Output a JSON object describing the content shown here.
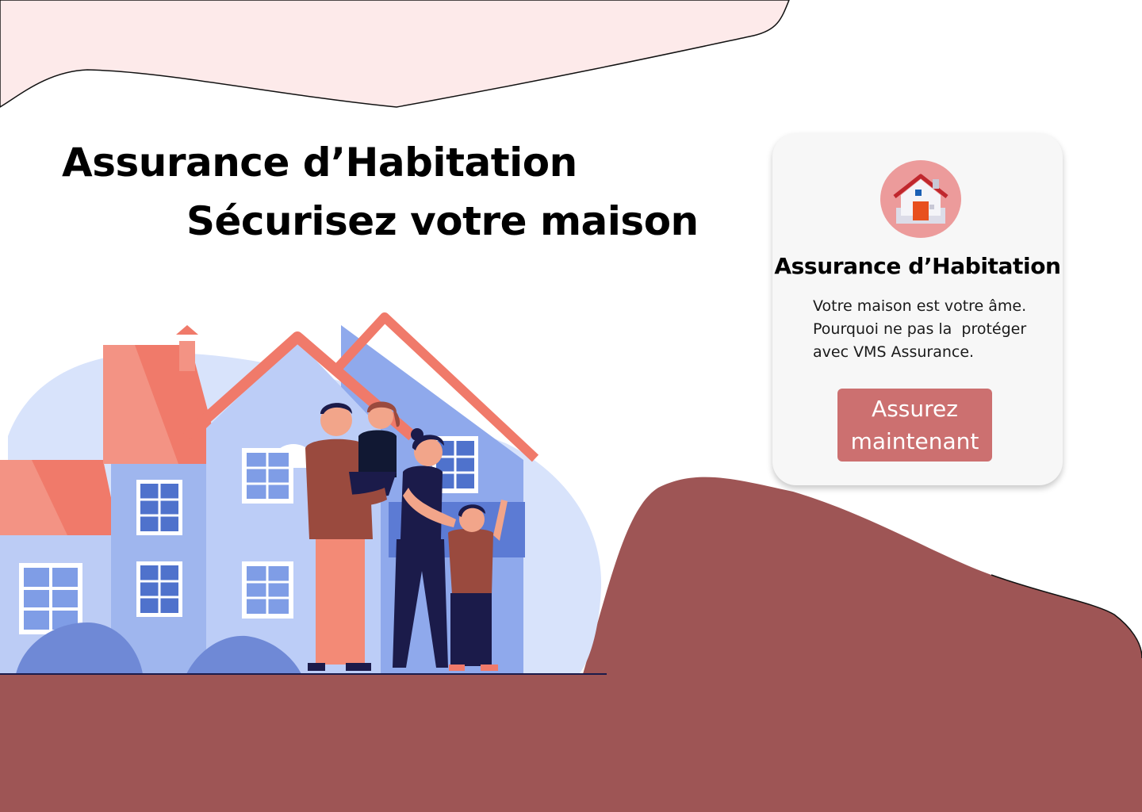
{
  "hero": {
    "title": "Assurance d’Habitation",
    "subtitle": "Sécurisez votre maison"
  },
  "card": {
    "icon": "house-icon",
    "title": "Assurance d’Habitation",
    "description_lines": [
      "Votre maison est votre âme.",
      "Pourquoi ne pas la  protéger",
      "avec VMS Assurance."
    ],
    "button_lines": [
      "Assurez",
      "maintenant"
    ]
  },
  "colors": {
    "top_blob": "#fdeaea",
    "bottom_ground": "#9e5555",
    "card_background": "#f7f7f7",
    "button": "#cc7070",
    "icon_circle": "#ec9b9b"
  },
  "illustration": {
    "name": "family-in-front-of-house-illustration"
  }
}
